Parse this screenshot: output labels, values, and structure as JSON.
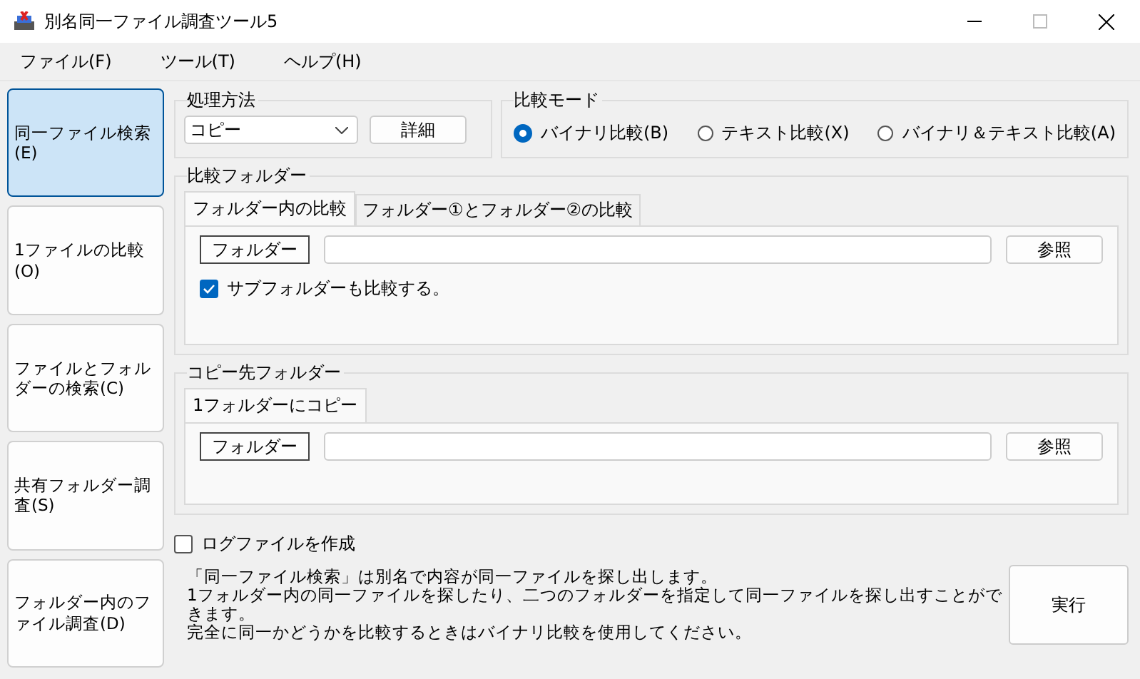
{
  "window": {
    "title": "別名同一ファイル調査ツール5"
  },
  "menu": [
    "ファイル(F)",
    "ツール(T)",
    "ヘルプ(H)"
  ],
  "sidebar": [
    {
      "label": "同一ファイル検索(E)",
      "selected": true
    },
    {
      "label": "1ファイルの比較(O)",
      "selected": false
    },
    {
      "label": "ファイルとフォルダーの検索(C)",
      "selected": false
    },
    {
      "label": "共有フォルダー調査(S)",
      "selected": false
    },
    {
      "label": "フォルダー内のファイル調査(D)",
      "selected": false
    }
  ],
  "processing": {
    "title": "処理方法",
    "method": "コピー",
    "detail_button": "詳細"
  },
  "compare_mode": {
    "title": "比較モード",
    "options": [
      {
        "label": "バイナリ比較(B)",
        "selected": true
      },
      {
        "label": "テキスト比較(X)",
        "selected": false
      },
      {
        "label": "バイナリ＆テキスト比較(A)",
        "selected": false
      }
    ]
  },
  "compare_folder": {
    "title": "比較フォルダー",
    "tabs": [
      {
        "label": "フォルダー内の比較",
        "selected": true
      },
      {
        "label": "フォルダー①とフォルダー②の比較",
        "selected": false
      }
    ],
    "folder_button": "フォルダー",
    "browse_button": "参照",
    "subfolder": {
      "label": "サブフォルダーも比較する。",
      "checked": true
    }
  },
  "copy_destination": {
    "title": "コピー先フォルダー",
    "tabs": [
      {
        "label": "1フォルダーにコピー",
        "selected": true
      }
    ],
    "folder_button": "フォルダー",
    "browse_button": "参照"
  },
  "log_file": {
    "label": "ログファイルを作成",
    "checked": false
  },
  "description": [
    "「同一ファイル検索」は別名で内容が同一ファイルを探し出します。",
    "1フォルダー内の同一ファイルを探したり、二つのフォルダーを指定して同一ファイルを探し出すことができます。",
    "完全に同一かどうかを比較するときはバイナリ比較を使用してください。"
  ],
  "run_button": "実行"
}
